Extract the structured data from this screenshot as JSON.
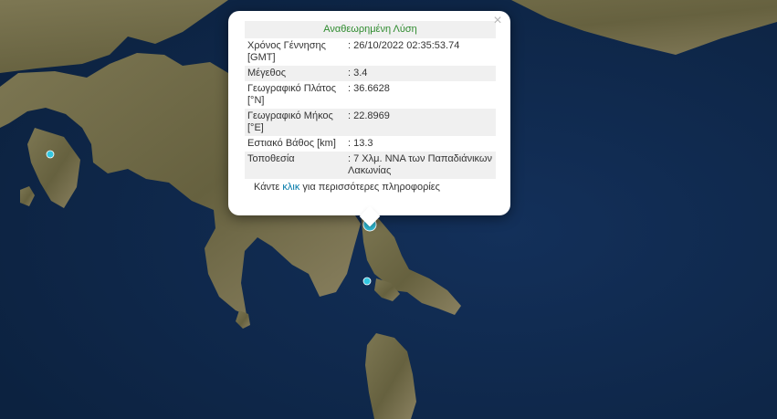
{
  "popup": {
    "title": "Αναθεωρημένη Λύση",
    "close_symbol": "×",
    "rows": [
      {
        "label": "Χρόνος Γέννησης [GMT]",
        "value": ": 26/10/2022 02:35:53.74"
      },
      {
        "label": "Μέγεθος",
        "value": ": 3.4"
      },
      {
        "label": "Γεωγραφικό Πλάτος [°N]",
        "value": ": 36.6628"
      },
      {
        "label": "Γεωγραφικό Μήκος [°E]",
        "value": ": 22.8969"
      },
      {
        "label": "Εστιακό Βάθος [km]",
        "value": ": 13.3"
      },
      {
        "label": "Τοποθεσία",
        "value": ": 7 Χλμ. ΝΝΑ των Παπαδιάνικων Λακωνίας"
      }
    ],
    "footer_prefix": "Κάντε ",
    "footer_link": "κλικ",
    "footer_suffix": " για περισσότερες πληροφορίες"
  },
  "colors": {
    "sea": "#0f2747",
    "land": "#6f6a4c",
    "marker": "#33c6e0",
    "title_green": "#2e8b2e",
    "link_blue": "#0078a8"
  }
}
